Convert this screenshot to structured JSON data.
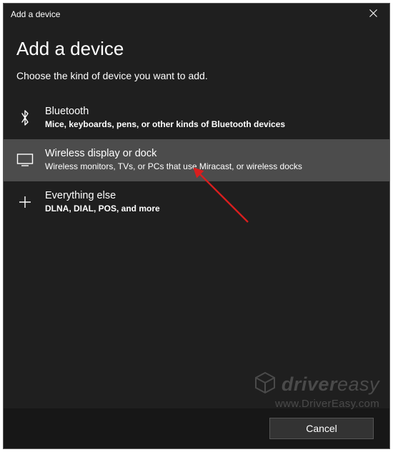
{
  "titlebar": {
    "title": "Add a device"
  },
  "heading": "Add a device",
  "subheading": "Choose the kind of device you want to add.",
  "options": [
    {
      "icon": "bluetooth-icon",
      "title": "Bluetooth",
      "desc": "Mice, keyboards, pens, or other kinds of Bluetooth devices"
    },
    {
      "icon": "display-icon",
      "title": "Wireless display or dock",
      "desc": "Wireless monitors, TVs, or PCs that use Miracast, or wireless docks"
    },
    {
      "icon": "plus-icon",
      "title": "Everything else",
      "desc": "DLNA, DIAL, POS, and more"
    }
  ],
  "footer": {
    "cancel_label": "Cancel"
  },
  "watermark": {
    "brand_a": "driver",
    "brand_b": "easy",
    "url": "www.DriverEasy.com"
  }
}
